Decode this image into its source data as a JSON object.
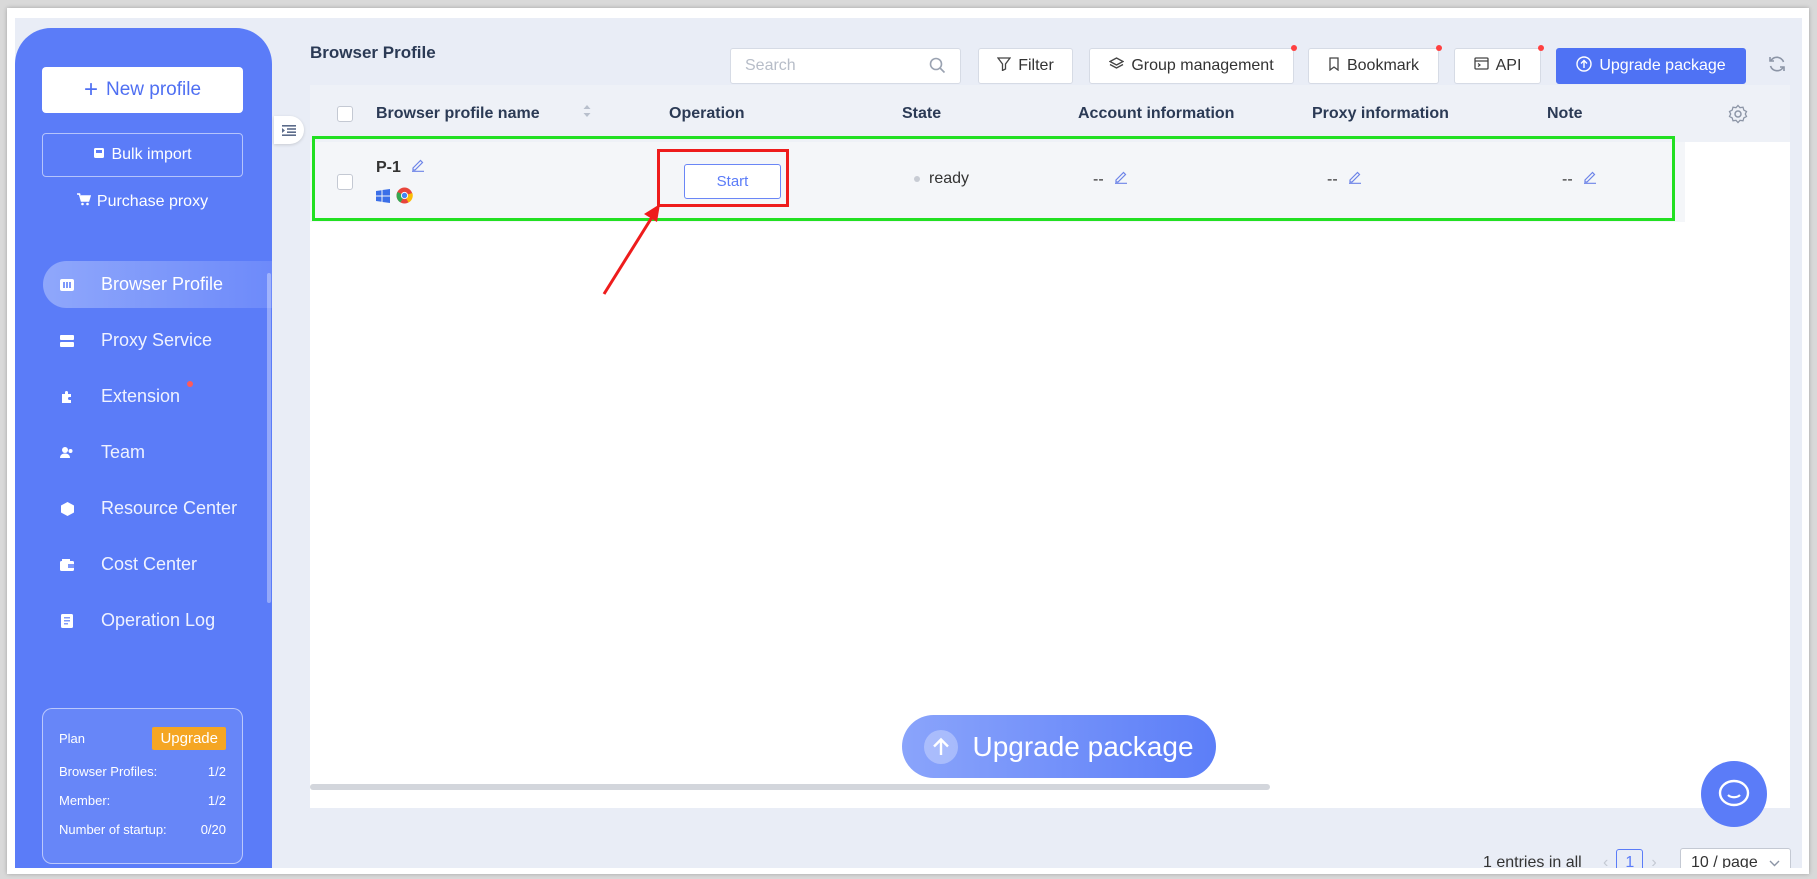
{
  "sidebar": {
    "new_profile": "New profile",
    "bulk_import": "Bulk import",
    "purchase_proxy": "Purchase proxy",
    "nav": [
      {
        "label": "Browser Profile",
        "icon": "browser-profile-icon",
        "active": true
      },
      {
        "label": "Proxy Service",
        "icon": "proxy-service-icon",
        "active": false
      },
      {
        "label": "Extension",
        "icon": "extension-icon",
        "active": false,
        "badge": true
      },
      {
        "label": "Team",
        "icon": "team-icon",
        "active": false
      },
      {
        "label": "Resource Center",
        "icon": "resource-center-icon",
        "active": false
      },
      {
        "label": "Cost Center",
        "icon": "cost-center-icon",
        "active": false
      },
      {
        "label": "Operation Log",
        "icon": "operation-log-icon",
        "active": false
      }
    ],
    "plan": {
      "label": "Plan",
      "upgrade": "Upgrade",
      "browser_profiles_label": "Browser Profiles:",
      "browser_profiles_value": "1/2",
      "member_label": "Member:",
      "member_value": "1/2",
      "startup_label": "Number of startup:",
      "startup_value": "0/20"
    }
  },
  "header": {
    "title": "Browser Profile",
    "search_placeholder": "Search",
    "filter": "Filter",
    "group_management": "Group management",
    "bookmark": "Bookmark",
    "api": "API",
    "upgrade_package": "Upgrade package"
  },
  "table": {
    "columns": [
      "Browser profile name",
      "Operation",
      "State",
      "Account information",
      "Proxy information",
      "Note"
    ],
    "rows": [
      {
        "name": "P-1",
        "operation": "Start",
        "state": "ready",
        "account": "--",
        "proxy": "--",
        "note": "--"
      }
    ]
  },
  "float_upgrade": "Upgrade package",
  "pagination": {
    "total": "1 entries in all",
    "current_page": "1",
    "page_size": "10 / page"
  },
  "colors": {
    "primary": "#5b7cf8",
    "annotation_green": "#22e022",
    "annotation_red": "#ee1c1c"
  }
}
